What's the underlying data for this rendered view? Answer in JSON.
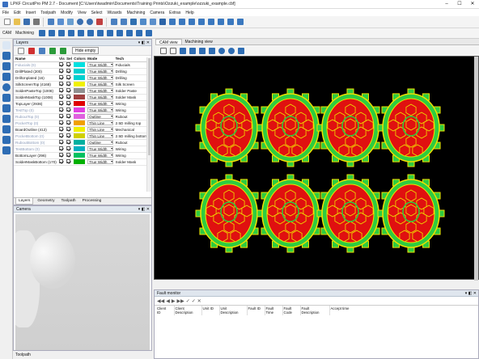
{
  "window": {
    "title": "LPKF CircuitPro PM 2.7 - Document [C:\\Users\\twadmin\\Documents\\Training Prints\\Ozzuki_example\\ozzuki_example.cbf]",
    "controls": [
      "–",
      "☐",
      "✕"
    ]
  },
  "menu": [
    "File",
    "Edit",
    "Insert",
    "Toolpath",
    "Modify",
    "View",
    "Select",
    "Wizards",
    "Machining",
    "Camera",
    "Extras",
    "Help"
  ],
  "toolbar2": {
    "cam_label": "CAM",
    "machining_label": "Machining"
  },
  "layers_panel": {
    "title": "Layers",
    "hide_empty_label": "Hide empty",
    "columns": [
      "Name",
      "Vis",
      "Sel",
      "Colors",
      "Mode",
      "Tech"
    ],
    "rows": [
      {
        "name": "Fiducials (0)",
        "vis": true,
        "sel": true,
        "color": "#00e0e0",
        "mode": "True Width",
        "tech": "Fiducials",
        "dim": true
      },
      {
        "name": "DrillPlated (200)",
        "vis": true,
        "sel": true,
        "color": "#00d0d0",
        "mode": "True Width",
        "tech": "Drilling",
        "dim": false
      },
      {
        "name": "DrillUnplated (16)",
        "vis": true,
        "sel": true,
        "color": "#00d0d0",
        "mode": "True Width",
        "tech": "Drilling",
        "dim": false
      },
      {
        "name": "SilkScreenTop (4168)",
        "vis": true,
        "sel": true,
        "color": "#f0f000",
        "mode": "True Width",
        "tech": "Silk Screen",
        "dim": false
      },
      {
        "name": "SolderPasteTop (1008)",
        "vis": true,
        "sel": true,
        "color": "#909090",
        "mode": "True Width",
        "tech": "Solder Paste",
        "dim": false
      },
      {
        "name": "SolderMaskTop (1008)",
        "vis": true,
        "sel": true,
        "color": "#a04040",
        "mode": "True Width",
        "tech": "Solder Mask",
        "dim": false
      },
      {
        "name": "TopLayer (2936)",
        "vis": true,
        "sel": true,
        "color": "#e00000",
        "mode": "True Width",
        "tech": "Wiring",
        "dim": false
      },
      {
        "name": "TestTop (0)",
        "vis": true,
        "sel": true,
        "color": "#e040e0",
        "mode": "True Width",
        "tech": "Wiring",
        "dim": true
      },
      {
        "name": "RuboutTop (0)",
        "vis": true,
        "sel": true,
        "color": "#e060e0",
        "mode": "Outline",
        "tech": "Rubout",
        "dim": true
      },
      {
        "name": "PocketTop (0)",
        "vis": true,
        "sel": true,
        "color": "#f0a000",
        "mode": "Thin Line",
        "tech": "2.5D milling top",
        "dim": true
      },
      {
        "name": "BoardOutline (412)",
        "vis": true,
        "sel": true,
        "color": "#f0f000",
        "mode": "Thin Line",
        "tech": "Mechanical",
        "dim": false
      },
      {
        "name": "PocketBottom (0)",
        "vis": true,
        "sel": true,
        "color": "#d0d000",
        "mode": "Thin Line",
        "tech": "2.5D milling bottom",
        "dim": true
      },
      {
        "name": "RuboutBottom (0)",
        "vis": true,
        "sel": true,
        "color": "#00b0a0",
        "mode": "Outline",
        "tech": "Rubout",
        "dim": true
      },
      {
        "name": "TestBottom (0)",
        "vis": true,
        "sel": true,
        "color": "#00b0c0",
        "mode": "True Width",
        "tech": "Wiring",
        "dim": true
      },
      {
        "name": "BottomLayer (296)",
        "vis": true,
        "sel": true,
        "color": "#00c060",
        "mode": "True Width",
        "tech": "Wiring",
        "dim": false
      },
      {
        "name": "SolderMaskBottom (170)",
        "vis": true,
        "sel": true,
        "color": "#00b000",
        "mode": "True Width",
        "tech": "Solder Mask",
        "dim": false
      }
    ],
    "tabs": [
      "Layers",
      "Geometry",
      "Toolpath",
      "Processing"
    ]
  },
  "camera_panel": {
    "title": "Camera"
  },
  "status_bottom": "Toolpath",
  "cam_tabs": [
    "CAM view",
    "Machining view"
  ],
  "fault_monitor": {
    "title": "Fault monitor",
    "columns": [
      "Client ID",
      "Client Description",
      "Unit ID",
      "Unit Description",
      "Fault ID",
      "Fault Time",
      "Fault Code",
      "Fault Description",
      "Accept time"
    ]
  },
  "colors": {
    "canvas_bg": "#000000",
    "pcb_red": "#e01010",
    "pcb_green": "#2ecc40",
    "pcb_yellow": "#f0e000"
  }
}
